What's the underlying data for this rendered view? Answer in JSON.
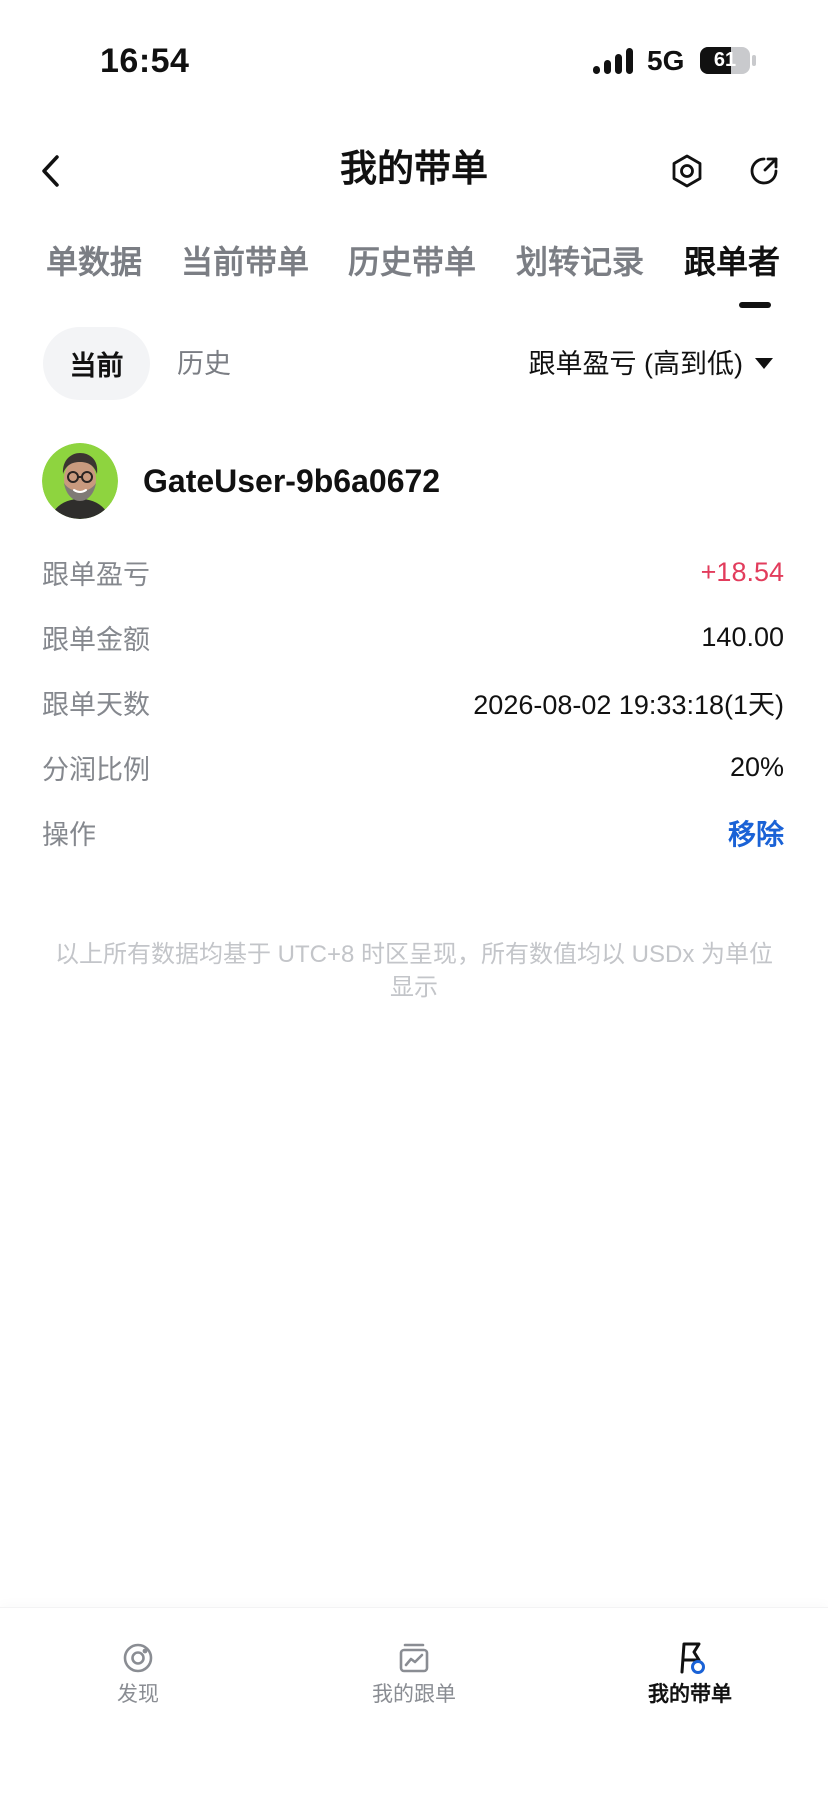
{
  "status_bar": {
    "time": "16:54",
    "network": "5G",
    "battery": {
      "level": 61
    }
  },
  "header": {
    "title": "我的带单",
    "back_icon": "chevron-left-icon",
    "settings_icon": "hexagon-settings-icon",
    "share_icon": "share-icon"
  },
  "tabs": [
    {
      "label": "单数据"
    },
    {
      "label": "当前带单"
    },
    {
      "label": "历史带单"
    },
    {
      "label": "划转记录"
    },
    {
      "label": "跟单者",
      "active": true
    }
  ],
  "subtabs": [
    {
      "label": "当前",
      "active": true
    },
    {
      "label": "历史"
    }
  ],
  "sort": {
    "label": "跟单盈亏 (高到低)",
    "icon": "caret-down-icon"
  },
  "follower": {
    "username": "GateUser-9b6a0672",
    "rows": [
      {
        "label": "跟单盈亏",
        "value": "+18.54"
      },
      {
        "label": "跟单金额",
        "value": "140.00"
      },
      {
        "label": "跟单天数",
        "value": "2026-08-02 19:33:18(1天)"
      },
      {
        "label": "分润比例",
        "value": "20%"
      },
      {
        "label": "操作",
        "action": "移除"
      }
    ]
  },
  "note": "以上所有数据均基于 UTC+8 时区呈现，所有数值均以 USDx 为单位显示",
  "bottom_nav": [
    {
      "label": "发现",
      "icon": "discover-icon"
    },
    {
      "label": "我的跟单",
      "icon": "copy-trading-icon"
    },
    {
      "label": "我的带单",
      "icon": "lead-trading-icon",
      "active": true
    }
  ],
  "colors": {
    "profit": "#e23c5c",
    "action": "#1a62d6",
    "accent": "#1a62d6"
  }
}
